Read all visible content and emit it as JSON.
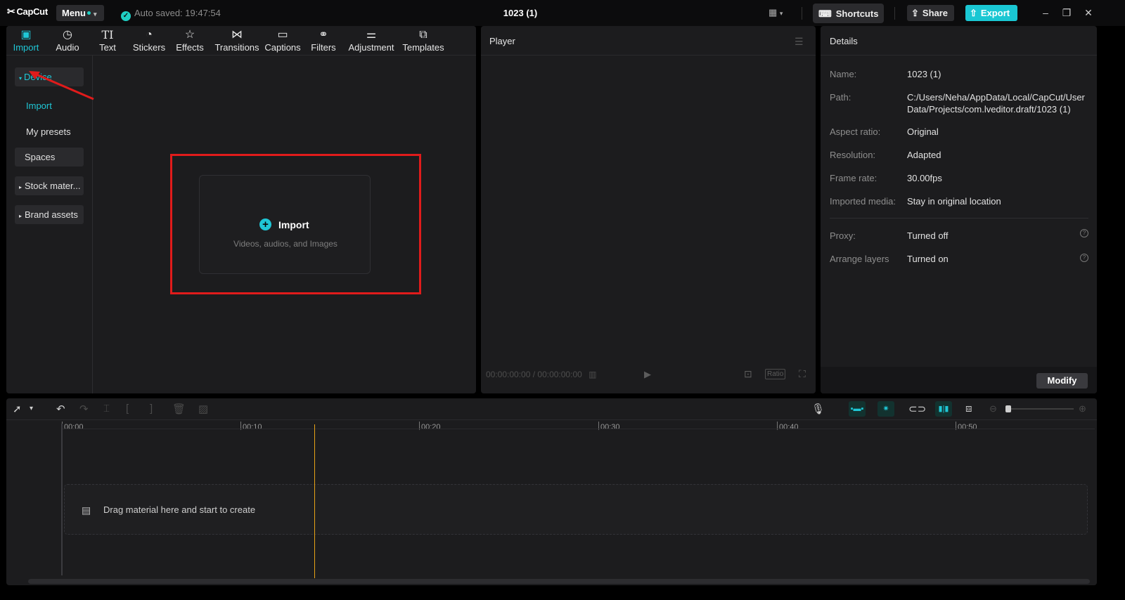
{
  "app": {
    "logo": "CapCut",
    "logo_icon": "capcut-logo-icon"
  },
  "topbar": {
    "menu_label": "Menu",
    "autosave": "Auto saved: 19:47:54",
    "project_title": "1023 (1)",
    "shortcuts_label": "Shortcuts",
    "share_label": "Share",
    "export_label": "Export",
    "accent_color": "#1ac7d3"
  },
  "media_tabs": [
    {
      "label": "Import",
      "icon": "import-icon",
      "active": true
    },
    {
      "label": "Audio",
      "icon": "audio-icon"
    },
    {
      "label": "Text",
      "icon": "text-icon"
    },
    {
      "label": "Stickers",
      "icon": "stickers-icon"
    },
    {
      "label": "Effects",
      "icon": "effects-icon"
    },
    {
      "label": "Transitions",
      "icon": "transitions-icon"
    },
    {
      "label": "Captions",
      "icon": "captions-icon"
    },
    {
      "label": "Filters",
      "icon": "filters-icon"
    },
    {
      "label": "Adjustment",
      "icon": "adjustment-icon"
    },
    {
      "label": "Templates",
      "icon": "templates-icon"
    }
  ],
  "sidebar": {
    "device": "Device",
    "import": "Import",
    "my_presets": "My presets",
    "spaces": "Spaces",
    "stock": "Stock mater...",
    "brand": "Brand assets"
  },
  "import_area": {
    "title": "Import",
    "subtitle": "Videos, audios, and Images"
  },
  "player": {
    "title": "Player",
    "timecode": "00:00:00:00 / 00:00:00:00",
    "ratio_label": "Ratio"
  },
  "details": {
    "title": "Details",
    "rows": [
      {
        "label": "Name:",
        "value": "1023 (1)"
      },
      {
        "label": "Path:",
        "value": "C:/Users/Neha/AppData/Local/CapCut/User Data/Projects/com.lveditor.draft/1023 (1)"
      },
      {
        "label": "Aspect ratio:",
        "value": "Original"
      },
      {
        "label": "Resolution:",
        "value": "Adapted"
      },
      {
        "label": "Frame rate:",
        "value": "30.00fps"
      },
      {
        "label": "Imported media:",
        "value": "Stay in original location"
      },
      {
        "label": "Proxy:",
        "value": "Turned off"
      },
      {
        "label": "Arrange layers",
        "value": "Turned on"
      }
    ],
    "modify_label": "Modify"
  },
  "timeline": {
    "ticks": [
      "00:00",
      "00:10",
      "00:20",
      "00:30",
      "00:40",
      "00:50"
    ],
    "drop_text": "Drag material here and start to create",
    "playhead_color": "#e8a317"
  },
  "annotation": {
    "highlight_color": "#e01b1b"
  }
}
